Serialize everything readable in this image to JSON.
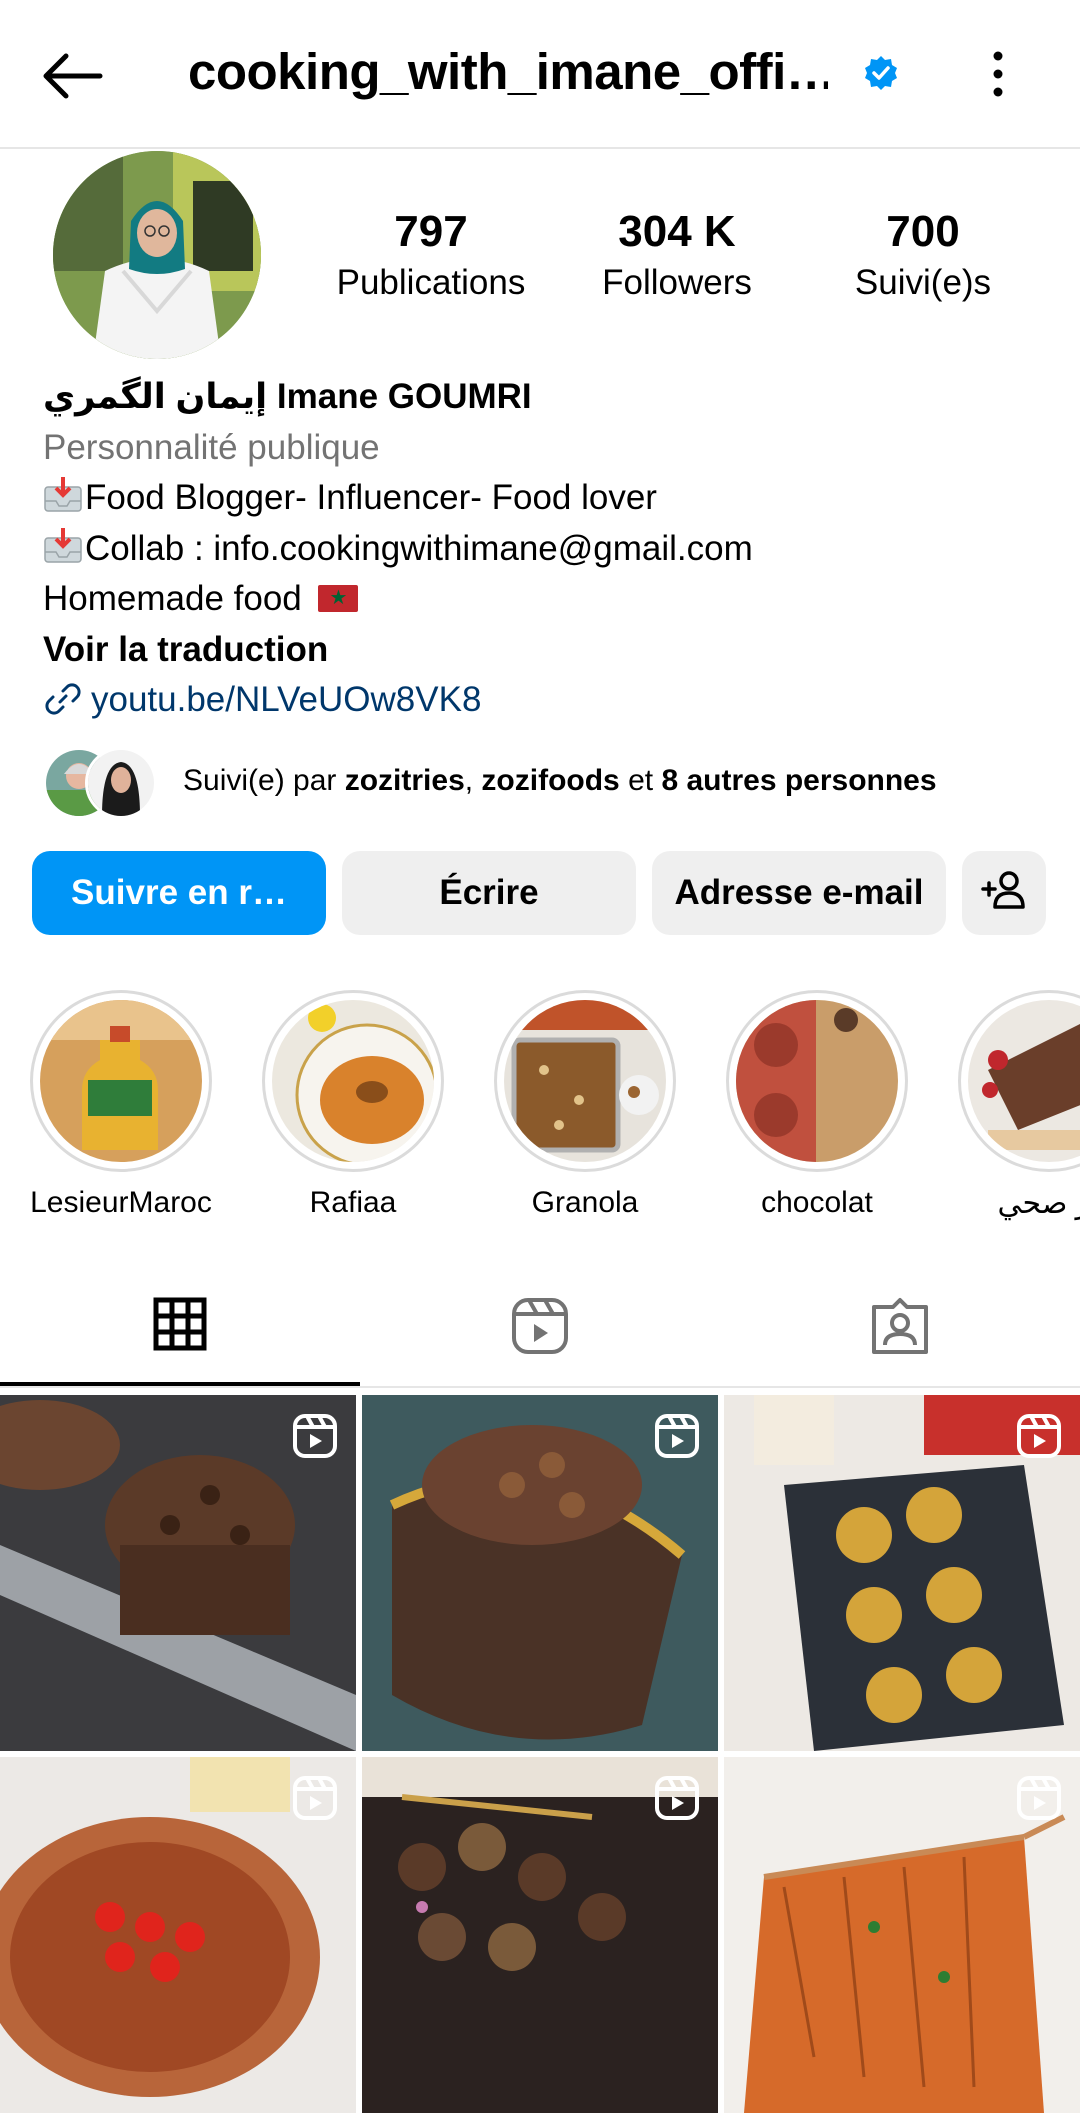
{
  "header": {
    "username": "cooking_with_imane_offi…",
    "verified": true,
    "back_icon": "arrow-left-icon",
    "menu_icon": "more-vertical-icon"
  },
  "profile": {
    "stats": [
      {
        "value": "797",
        "label": "Publications"
      },
      {
        "value": "304 K",
        "label": "Followers"
      },
      {
        "value": "700",
        "label": "Suivi(e)s"
      }
    ],
    "name": "إيمان الگمري Imane GOUMRI",
    "category": "Personnalité publique",
    "bio_line1": "Food Blogger- Influencer- Food lover",
    "bio_line2": "Collab : info.cookingwithimane@gmail.com",
    "bio_line3": "Homemade food",
    "translate": "Voir la traduction",
    "link": "youtu.be/NLVeUOw8VK8"
  },
  "followed_by": {
    "prefix": "Suivi(e) par ",
    "user1": "zozitries",
    "sep": ", ",
    "user2": "zozifoods",
    "mid": " et ",
    "others": "8 autres personnes"
  },
  "buttons": {
    "follow": "Suivre en r…",
    "message": "Écrire",
    "email": "Adresse e-mail",
    "add_user_icon": "add-user-icon"
  },
  "highlights": [
    {
      "label": "LesieurMaroc"
    },
    {
      "label": "Rafiaa"
    },
    {
      "label": "Granola"
    },
    {
      "label": "chocolat"
    },
    {
      "label": "يز صحي"
    }
  ],
  "tabs": [
    {
      "icon": "grid-icon",
      "active": true
    },
    {
      "icon": "reels-icon",
      "active": false
    },
    {
      "icon": "tagged-icon",
      "active": false
    }
  ],
  "colors": {
    "accent": "#0095f6",
    "verified": "#0095f6",
    "link": "#00376b",
    "secondary_text": "#737373",
    "button_bg": "#efefef"
  }
}
